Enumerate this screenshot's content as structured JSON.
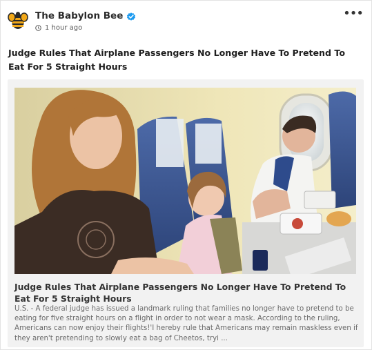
{
  "header": {
    "source_name": "The Babylon Bee",
    "time_ago": "1 hour ago",
    "more_label": "•••"
  },
  "post": {
    "title": "Judge Rules That Airplane Passengers No Longer Have To Pretend To Eat For 5 Straight Hours"
  },
  "article": {
    "title": "Judge Rules That Airplane Passengers No Longer Have To Pretend To Eat For 5 Straight Hours",
    "summary": "U.S. - A federal judge has issued a landmark ruling that families no longer have to pretend to be eating for five straight hours on a flight in order to not wear a mask. According to the ruling, Americans can now enjoy their flights!'I hereby rule that Americans may remain maskless even if they aren't pretending to slowly eat a bag of Cheetos, tryi ..."
  },
  "colors": {
    "verified": "#1d9bf0",
    "bee_yellow": "#f2a818",
    "bee_dark": "#2a2a2a"
  },
  "icons": [
    "bee-logo-icon",
    "verified-badge-icon",
    "clock-icon",
    "more-options-icon"
  ]
}
